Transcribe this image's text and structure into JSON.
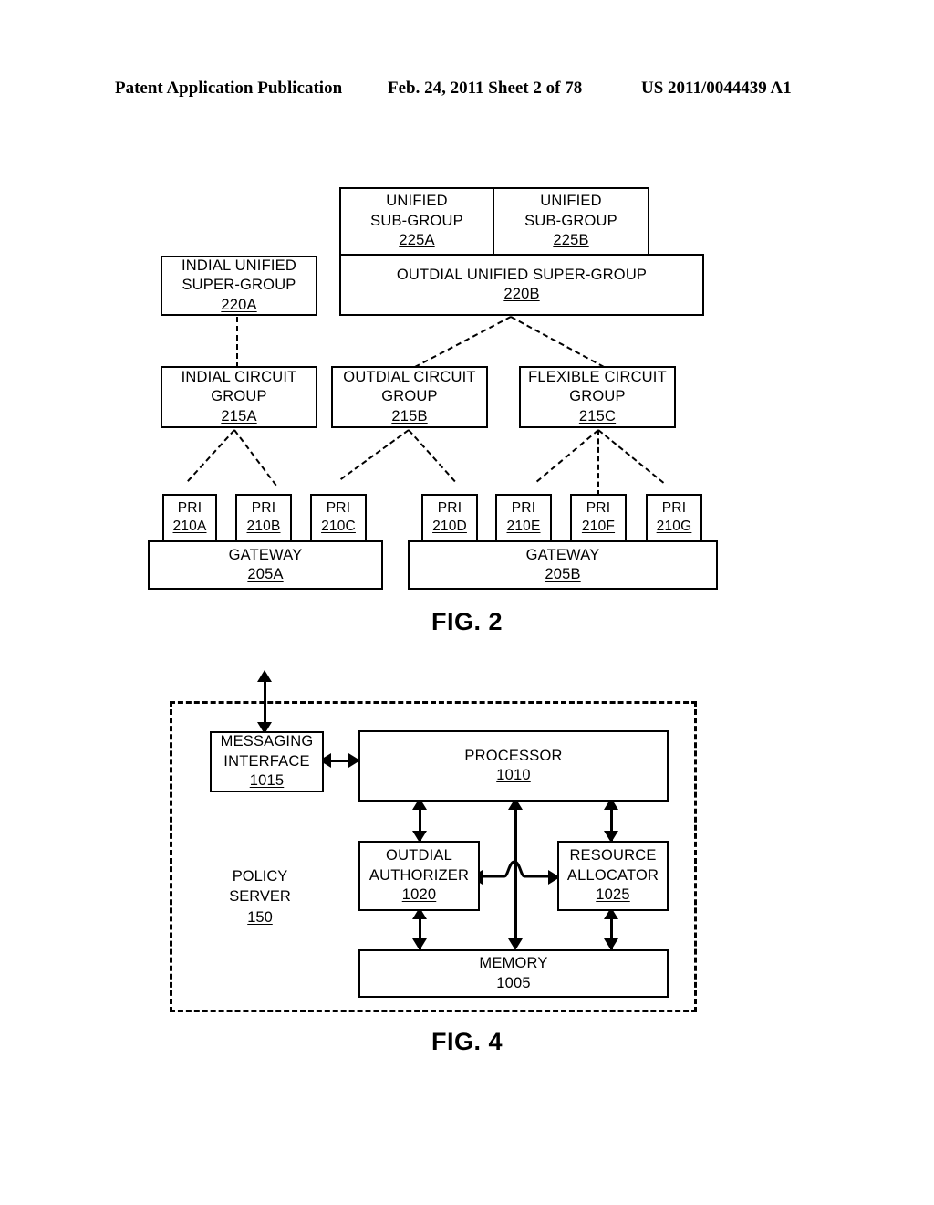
{
  "header": {
    "left": "Patent Application Publication",
    "middle": "Feb. 24, 2011  Sheet 2 of 78",
    "right": "US 2011/0044439 A1"
  },
  "fig2": {
    "caption": "FIG. 2",
    "boxes": {
      "unified_subgroup_a": {
        "line1": "UNIFIED",
        "line2": "SUB-GROUP",
        "ref": "225A"
      },
      "unified_subgroup_b": {
        "line1": "UNIFIED",
        "line2": "SUB-GROUP",
        "ref": "225B"
      },
      "indial_unified_supergroup": {
        "line1": "INDIAL UNIFIED",
        "line2": "SUPER-GROUP",
        "ref": "220A"
      },
      "outdial_unified_supergroup": {
        "line1": "OUTDIAL UNIFIED SUPER-GROUP",
        "ref": "220B"
      },
      "indial_circuit_group": {
        "line1": "INDIAL CIRCUIT",
        "line2": "GROUP",
        "ref": "215A"
      },
      "outdial_circuit_group": {
        "line1": "OUTDIAL CIRCUIT",
        "line2": "GROUP",
        "ref": "215B"
      },
      "flexible_circuit_group": {
        "line1": "FLEXIBLE CIRCUIT",
        "line2": "GROUP",
        "ref": "215C"
      },
      "pri_a": {
        "line1": "PRI",
        "ref": "210A"
      },
      "pri_b": {
        "line1": "PRI",
        "ref": "210B"
      },
      "pri_c": {
        "line1": "PRI",
        "ref": "210C"
      },
      "pri_d": {
        "line1": "PRI",
        "ref": "210D"
      },
      "pri_e": {
        "line1": "PRI",
        "ref": "210E"
      },
      "pri_f": {
        "line1": "PRI",
        "ref": "210F"
      },
      "pri_g": {
        "line1": "PRI",
        "ref": "210G"
      },
      "gateway_a": {
        "line1": "GATEWAY",
        "ref": "205A"
      },
      "gateway_b": {
        "line1": "GATEWAY",
        "ref": "205B"
      }
    }
  },
  "fig4": {
    "caption": "FIG. 4",
    "boundary_label": {
      "line1": "POLICY",
      "line2": "SERVER",
      "ref": "150"
    },
    "boxes": {
      "messaging_interface": {
        "line1": "MESSAGING",
        "line2": "INTERFACE",
        "ref": "1015"
      },
      "processor": {
        "line1": "PROCESSOR",
        "ref": "1010"
      },
      "outdial_authorizer": {
        "line1": "OUTDIAL",
        "line2": "AUTHORIZER",
        "ref": "1020"
      },
      "resource_allocator": {
        "line1": "RESOURCE",
        "line2": "ALLOCATOR",
        "ref": "1025"
      },
      "memory": {
        "line1": "MEMORY",
        "ref": "1005"
      }
    }
  }
}
